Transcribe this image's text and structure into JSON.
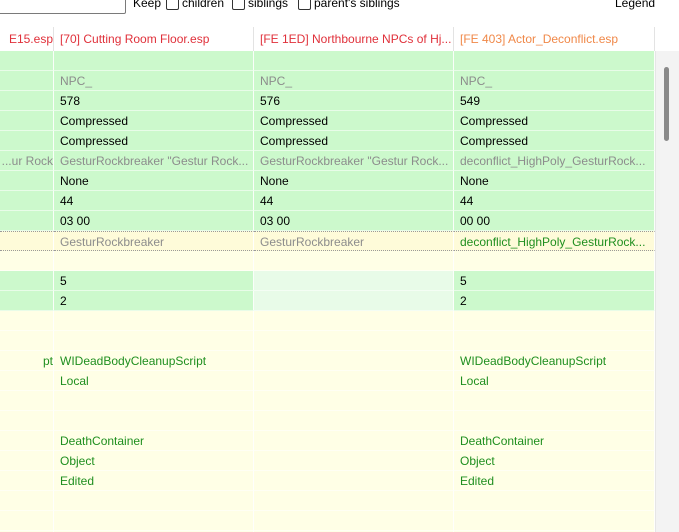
{
  "toolbar": {
    "keep_label": "Keep",
    "children_label": "children",
    "siblings_label": "siblings",
    "parents_siblings_label": "parent's siblings",
    "legend_label": "Legend"
  },
  "columns": [
    {
      "label": "E15.esp",
      "color": "#e0303a"
    },
    {
      "label": "[70] Cutting Room Floor.esp",
      "color": "#e0303a"
    },
    {
      "label": "[FE 1ED] Northbourne NPCs of Hj...",
      "color": "#e0303a"
    },
    {
      "label": "[FE 403] Actor_Deconflict.esp",
      "color": "#f08848"
    }
  ],
  "colors": {
    "green_row": "#ccf9cc",
    "green_row_light": "#e8fbe8",
    "yellow_row": "#ffffe6",
    "yellow_row_deep": "#fefbd9",
    "text_green": "#1f8f1f",
    "text_gray": "#8c8c8c",
    "text_black": "#000000",
    "scrollbar_thumb": "#8a8a8a"
  },
  "rows": [
    {
      "bg": "green",
      "cells": [
        "",
        "",
        "",
        ""
      ],
      "colors": [
        "black",
        "black",
        "black",
        "black"
      ]
    },
    {
      "bg": "green",
      "cells": [
        "",
        "NPC_",
        "NPC_",
        "NPC_"
      ],
      "colors": [
        "gray",
        "gray",
        "gray",
        "gray"
      ]
    },
    {
      "bg": "green",
      "cells": [
        "",
        "578",
        "576",
        "549"
      ],
      "colors": [
        "black",
        "black",
        "black",
        "black"
      ]
    },
    {
      "bg": "green",
      "cells": [
        "",
        "Compressed",
        "Compressed",
        "Compressed"
      ],
      "colors": [
        "black",
        "black",
        "black",
        "black"
      ]
    },
    {
      "bg": "green",
      "cells": [
        "",
        "Compressed",
        "Compressed",
        "Compressed"
      ],
      "colors": [
        "black",
        "black",
        "black",
        "black"
      ]
    },
    {
      "bg": "green",
      "cells": [
        "ur Rock...",
        "GesturRockbreaker \"Gestur Rock...",
        "GesturRockbreaker \"Gestur Rock...",
        "deconflict_HighPoly_GesturRock..."
      ],
      "colors": [
        "gray",
        "gray",
        "gray",
        "gray"
      ]
    },
    {
      "bg": "green",
      "cells": [
        "",
        "None",
        "None",
        "None"
      ],
      "colors": [
        "black",
        "black",
        "black",
        "black"
      ]
    },
    {
      "bg": "green",
      "cells": [
        "",
        "44",
        "44",
        "44"
      ],
      "colors": [
        "black",
        "black",
        "black",
        "black"
      ]
    },
    {
      "bg": "green",
      "cells": [
        "",
        "03 00",
        "03 00",
        "00 00"
      ],
      "colors": [
        "black",
        "black",
        "black",
        "black"
      ]
    },
    {
      "bg": "yellow",
      "cells": [
        "",
        "GesturRockbreaker",
        "GesturRockbreaker",
        "deconflict_HighPoly_GesturRock..."
      ],
      "colors": [
        "gray",
        "gray",
        "gray",
        "green"
      ]
    },
    {
      "bg": "yellow",
      "cells": [
        "",
        "",
        "",
        ""
      ],
      "colors": [
        "black",
        "black",
        "black",
        "black"
      ]
    },
    {
      "bg": "mixed",
      "cells": [
        "",
        "5",
        "",
        "5"
      ],
      "colors": [
        "black",
        "black",
        "black",
        "black"
      ]
    },
    {
      "bg": "mixed",
      "cells": [
        "",
        "2",
        "",
        "2"
      ],
      "colors": [
        "black",
        "black",
        "black",
        "black"
      ]
    },
    {
      "bg": "yellow",
      "cells": [
        "",
        "",
        "",
        ""
      ],
      "colors": [
        "black",
        "black",
        "black",
        "black"
      ]
    },
    {
      "bg": "yellow",
      "cells": [
        "",
        "",
        "",
        ""
      ],
      "colors": [
        "black",
        "black",
        "black",
        "black"
      ]
    },
    {
      "bg": "yellow",
      "cells": [
        "pt",
        "WIDeadBodyCleanupScript",
        "",
        "WIDeadBodyCleanupScript"
      ],
      "colors": [
        "green",
        "green",
        "green",
        "green"
      ]
    },
    {
      "bg": "yellow",
      "cells": [
        "",
        "Local",
        "",
        "Local"
      ],
      "colors": [
        "green",
        "green",
        "green",
        "green"
      ]
    },
    {
      "bg": "yellow",
      "cells": [
        "",
        "",
        "",
        ""
      ],
      "colors": [
        "black",
        "black",
        "black",
        "black"
      ]
    },
    {
      "bg": "yellow",
      "cells": [
        "",
        "",
        "",
        ""
      ],
      "colors": [
        "black",
        "black",
        "black",
        "black"
      ]
    },
    {
      "bg": "yellow",
      "cells": [
        "",
        "DeathContainer",
        "",
        "DeathContainer"
      ],
      "colors": [
        "green",
        "green",
        "green",
        "green"
      ]
    },
    {
      "bg": "yellow",
      "cells": [
        "",
        "Object",
        "",
        "Object"
      ],
      "colors": [
        "green",
        "green",
        "green",
        "green"
      ]
    },
    {
      "bg": "yellow",
      "cells": [
        "",
        "Edited",
        "",
        "Edited"
      ],
      "colors": [
        "green",
        "green",
        "green",
        "green"
      ]
    },
    {
      "bg": "yellow",
      "cells": [
        "",
        "",
        "",
        ""
      ],
      "colors": [
        "black",
        "black",
        "black",
        "black"
      ]
    },
    {
      "bg": "yellow",
      "cells": [
        "",
        "",
        "",
        ""
      ],
      "colors": [
        "black",
        "black",
        "black",
        "black"
      ]
    },
    {
      "bg": "yellow",
      "cells": [
        "",
        "",
        "",
        ""
      ],
      "colors": [
        "black",
        "black",
        "black",
        "black"
      ]
    }
  ]
}
